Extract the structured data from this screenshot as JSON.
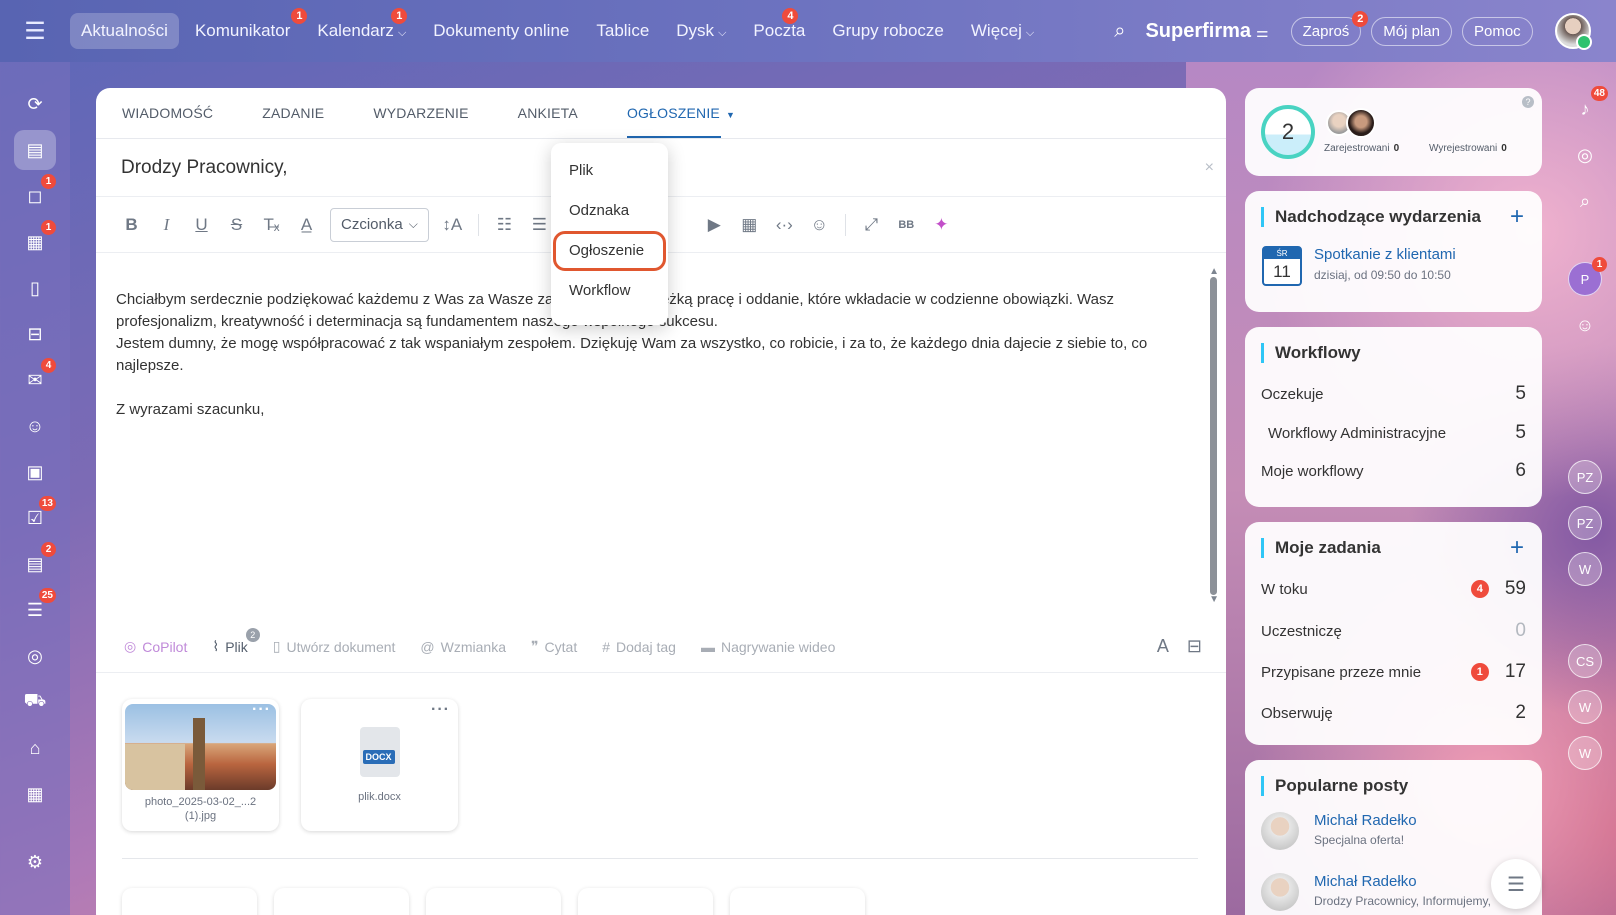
{
  "topnav": {
    "menu_icon": "hamburger-icon",
    "items": [
      {
        "label": "Aktualności",
        "badge": ""
      },
      {
        "label": "Komunikator",
        "badge": "1"
      },
      {
        "label": "Kalendarz",
        "badge": "1"
      },
      {
        "label": "Dokumenty online",
        "badge": ""
      },
      {
        "label": "Tablice",
        "badge": ""
      },
      {
        "label": "Dysk",
        "badge": ""
      },
      {
        "label": "Poczta",
        "badge": "4"
      },
      {
        "label": "Grupy robocze",
        "badge": ""
      },
      {
        "label": "Więcej",
        "badge": ""
      }
    ],
    "brand": "Superfirma",
    "invite_label": "Zaproś",
    "invite_badge": "2",
    "plan_label": "Mój plan",
    "help_label": "Pomoc"
  },
  "sidebar": {
    "items": [
      {
        "icon": "activity-stream-icon",
        "badge": ""
      },
      {
        "icon": "feed-icon",
        "badge": ""
      },
      {
        "icon": "chat-icon",
        "badge": "1"
      },
      {
        "icon": "calendar-icon",
        "badge": "1"
      },
      {
        "icon": "document-icon",
        "badge": ""
      },
      {
        "icon": "drive-icon",
        "badge": ""
      },
      {
        "icon": "mail-icon",
        "badge": "4"
      },
      {
        "icon": "groups-icon",
        "badge": ""
      },
      {
        "icon": "boards-icon",
        "badge": ""
      },
      {
        "icon": "tasks-icon",
        "badge": "13"
      },
      {
        "icon": "crm-icon",
        "badge": "2"
      },
      {
        "icon": "automation-icon",
        "badge": "25"
      },
      {
        "icon": "target-icon",
        "badge": ""
      },
      {
        "icon": "shop-icon",
        "badge": ""
      },
      {
        "icon": "warehouse-icon",
        "badge": ""
      },
      {
        "icon": "schedule-icon",
        "badge": ""
      },
      {
        "icon": "settings-icon",
        "badge": ""
      }
    ]
  },
  "composer": {
    "tabs": [
      "WIADOMOŚĆ",
      "ZADANIE",
      "WYDARZENIE",
      "ANKIETA",
      "OGŁOSZENIE"
    ],
    "active_tab": "OGŁOSZENIE",
    "title": "Drodzy Pracownicy,",
    "font_select": "Czcionka",
    "body": [
      "Chciałbym serdecznie podziękować każdemu z Was za Wasze zaangażowanie, ciężką pracę i oddanie, które wkładacie w codzienne obowiązki. Wasz profesjonalizm, kreatywność i determinacja są fundamentem naszego wspólnego sukcesu.",
      "Jestem dumny, że mogę współpracować z tak wspaniałym zespołem. Dziękuję Wam za wszystko, co robicie, i za to, że każdego dnia dajecie z siebie to, co najlepsze.",
      "Z wyrazami szacunku,"
    ],
    "bottom_tools": {
      "copilot": "CoPilot",
      "file": "Plik",
      "file_badge": "2",
      "create_doc": "Utwórz dokument",
      "mention": "Wzmianka",
      "quote": "Cytat",
      "tag": "Dodaj tag",
      "video": "Nagrywanie wideo"
    },
    "attachments": [
      {
        "name_line1": "photo_2025-03-02_...2",
        "name_line2": "(1).jpg"
      },
      {
        "name": "plik.docx",
        "type_label": "DOCX"
      }
    ]
  },
  "dropdown": {
    "items": [
      "Plik",
      "Odznaka",
      "Ogłoszenie",
      "Workflow"
    ],
    "selected": "Ogłoszenie",
    "highlight_color": "#e0572f"
  },
  "right": {
    "registration": {
      "count": "2",
      "registered_label": "Zarejestrowani",
      "registered_value": "0",
      "unregistered_label": "Wyrejestrowani",
      "unregistered_value": "0"
    },
    "events": {
      "title": "Nadchodzące wydarzenia",
      "day_abbr": "ŚR",
      "day_num": "11",
      "event_title": "Spotkanie z klientami",
      "event_time": "dzisiaj, od 09:50 do 10:50"
    },
    "workflows": {
      "title": "Workflowy",
      "rows": [
        {
          "label": "Oczekuje",
          "value": "5"
        },
        {
          "label": "Workflowy Administracyjne",
          "value": "5"
        },
        {
          "label": "Moje workflowy",
          "value": "6"
        }
      ]
    },
    "tasks": {
      "title": "Moje zadania",
      "rows": [
        {
          "label": "W toku",
          "badge": "4",
          "value": "59"
        },
        {
          "label": "Uczestniczę",
          "badge": "",
          "value": "0"
        },
        {
          "label": "Przypisane przeze mnie",
          "badge": "1",
          "value": "17"
        },
        {
          "label": "Obserwuję",
          "badge": "",
          "value": "2"
        }
      ]
    },
    "popular": {
      "title": "Popularne posty",
      "posts": [
        {
          "author": "Michał Radełko",
          "text": "Specjalna oferta!"
        },
        {
          "author": "Michał Radełko",
          "text": "Drodzy Pracownicy, Informujemy,"
        }
      ]
    }
  },
  "rail": {
    "notifications_badge": "48",
    "items": [
      "P",
      "PZ",
      "PZ",
      "W",
      "CS",
      "W",
      "W"
    ],
    "p_badge": "1"
  },
  "colors": {
    "accent": "#2067b0",
    "badge": "#ef4b3c",
    "brand_bg": "#5864b2"
  }
}
